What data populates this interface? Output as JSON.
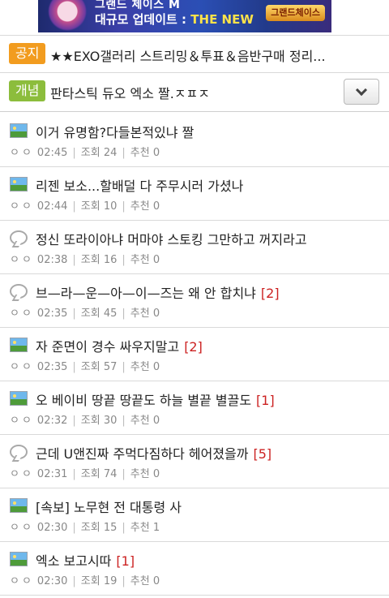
{
  "banner": {
    "line1": "그랜드 체이스 M",
    "line2_prefix": "대규모 업데이트 : ",
    "line2_highlight": "THE NEW",
    "logo_text": "그랜드체이스"
  },
  "notice": {
    "tag": "공지",
    "text": "★★EXO갤러리 스트리밍＆투표＆음반구매 정리..."
  },
  "concept": {
    "tag": "개념",
    "text": "판타스틱 듀오 엑소 짤.ㅈㅍㅈ"
  },
  "posts": [
    {
      "icon": "image-icon",
      "title": "이거 유명함?다들본적있냐 짤",
      "count": "",
      "author": "ㅇㅇ",
      "time": "02:45",
      "views": "조회 24",
      "recommends": "추천 0"
    },
    {
      "icon": "image-icon",
      "title": "리젠 보소...할배덜 다 주무시러 가셨나",
      "count": "",
      "author": "ㅇㅇ",
      "time": "02:44",
      "views": "조회 10",
      "recommends": "추천 0"
    },
    {
      "icon": "speech-bubble-icon",
      "title": "정신 또라이아냐 머마야 스토킹 그만하고 꺼지라고",
      "count": "",
      "author": "ㅇㅇ",
      "time": "02:38",
      "views": "조회 16",
      "recommends": "추천 0"
    },
    {
      "icon": "speech-bubble-icon",
      "title": "브—라—운—아—이—즈는 왜 안 합치냐",
      "count": "[2]",
      "author": "ㅇㅇ",
      "time": "02:35",
      "views": "조회 45",
      "recommends": "추천 0"
    },
    {
      "icon": "image-icon",
      "title": "자 준면이 경수 싸우지말고",
      "count": "[2]",
      "author": "ㅇㅇ",
      "time": "02:35",
      "views": "조회 57",
      "recommends": "추천 0"
    },
    {
      "icon": "image-icon",
      "title": "오 베이비 땅끝 땅끝도 하늘 별끝 별끌도",
      "count": "[1]",
      "author": "ㅇㅇ",
      "time": "02:32",
      "views": "조회 30",
      "recommends": "추천 0"
    },
    {
      "icon": "speech-bubble-icon",
      "title": "근데 U앤진짜 주먹다짐하다 헤어졌을까",
      "count": "[5]",
      "author": "ㅇㅇ",
      "time": "02:31",
      "views": "조회 74",
      "recommends": "추천 0"
    },
    {
      "icon": "image-icon",
      "title": "[속보] 노무현 전 대통령 사",
      "count": "",
      "author": "ㅇㅇ",
      "time": "02:30",
      "views": "조회 15",
      "recommends": "추천 1"
    },
    {
      "icon": "image-icon",
      "title": "엑소 보고시따",
      "count": "[1]",
      "author": "ㅇㅇ",
      "time": "02:30",
      "views": "조회 19",
      "recommends": "추천 0"
    }
  ],
  "colors": {
    "notice_tag": "#f29c1f",
    "concept_tag": "#8cbd3c",
    "comment_count": "#cc2222"
  }
}
